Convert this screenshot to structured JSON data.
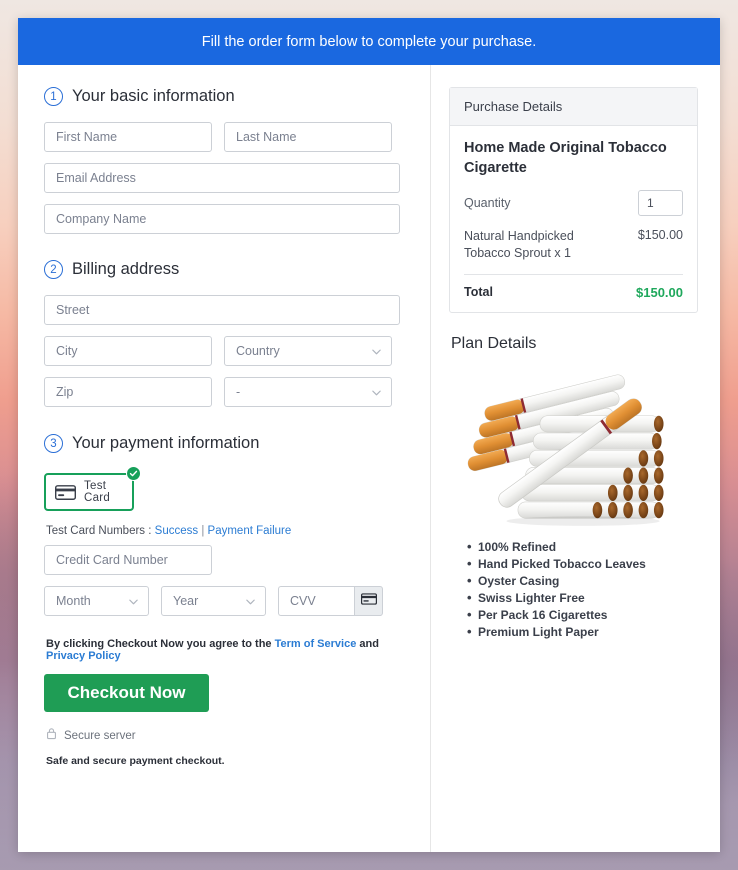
{
  "banner": {
    "text": "Fill the order form below to complete your purchase."
  },
  "sections": {
    "basic": {
      "number": "1",
      "title": "Your basic information",
      "fields": {
        "first_name": "First Name",
        "last_name": "Last Name",
        "email": "Email Address",
        "company": "Company Name"
      }
    },
    "billing": {
      "number": "2",
      "title": "Billing address",
      "fields": {
        "street": "Street",
        "city": "City",
        "country": "Country",
        "zip": "Zip",
        "state": "-"
      }
    },
    "payment": {
      "number": "3",
      "title": "Your payment information",
      "tile_label": "Test Card",
      "tile_selected": true,
      "test_numbers_label": "Test Card Numbers :",
      "link_success": "Success",
      "link_separator": "|",
      "link_failure": "Payment Failure",
      "card_number": "Credit Card Number",
      "month": "Month",
      "year": "Year",
      "cvv": "CVV"
    }
  },
  "footer": {
    "terms_prefix": "By clicking Checkout Now you agree to the",
    "terms_link": "Term of Service",
    "terms_and": "and",
    "privacy_link": "Privacy Policy",
    "checkout_label": "Checkout Now",
    "secure_server": "Secure server",
    "safe_note": "Safe and secure payment checkout."
  },
  "purchase": {
    "heading": "Purchase Details",
    "product_name": "Home Made Original Tobacco Cigarette",
    "quantity_label": "Quantity",
    "quantity_value": "1",
    "line_item_desc": "Natural Handpicked Tobacco Sprout x 1",
    "line_item_amount": "$150.00",
    "total_label": "Total",
    "total_amount": "$150.00"
  },
  "plan": {
    "title": "Plan Details",
    "features": [
      "100% Refined",
      "Hand Picked Tobacco Leaves",
      "Oyster Casing",
      "Swiss Lighter Free",
      "Per Pack 16 Cigarettes",
      "Premium Light Paper"
    ]
  },
  "colors": {
    "banner_blue": "#1a68e0",
    "accent_blue": "#2b7cd3",
    "success_green": "#1f9d55",
    "total_green": "#1fa85c",
    "tile_border_green": "#17a05a"
  }
}
